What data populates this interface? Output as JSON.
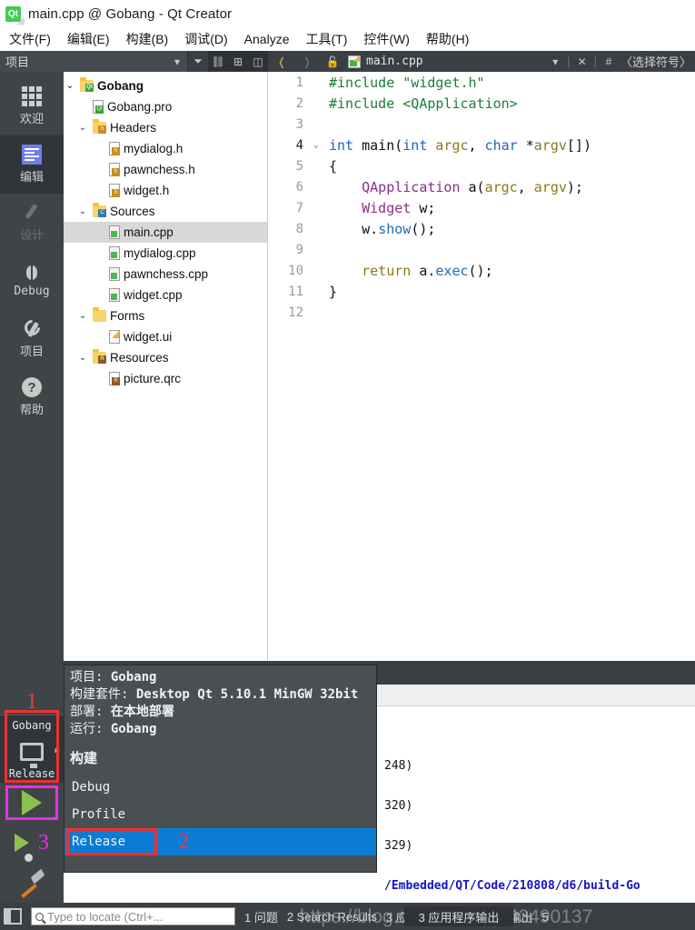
{
  "window": {
    "title": "main.cpp @ Gobang - Qt Creator",
    "logo_icon": "qt-logo-icon",
    "logo_text": "Qt"
  },
  "menubar": [
    {
      "label": "文件(F)"
    },
    {
      "label": "编辑(E)"
    },
    {
      "label": "构建(B)"
    },
    {
      "label": "调试(D)"
    },
    {
      "label": "Analyze"
    },
    {
      "label": "工具(T)"
    },
    {
      "label": "控件(W)"
    },
    {
      "label": "帮助(H)"
    }
  ],
  "toolbar": {
    "project_selector": "项目",
    "dropdown_icon": "chevron-down-icon",
    "filter_icon": "filter-icon",
    "link_icon": "link-icon",
    "split_icon": "split-add-icon",
    "sidebar_icon": "sidebar-toggle-icon",
    "back_icon": "back-arrow-icon",
    "forward_icon": "forward-arrow-icon",
    "lock_icon": "unlock-icon"
  },
  "editor_tab": {
    "file_icon": "cpp-file-icon",
    "filename": "main.cpp",
    "dropdown_icon": "chevron-down-icon",
    "close_icon": "close-icon",
    "hash": "#",
    "symbol_selector": "〈选择符号〉"
  },
  "modebar": [
    {
      "label": "欢迎",
      "icon": "grid-welcome-icon",
      "state": "normal"
    },
    {
      "label": "编辑",
      "icon": "edit-document-icon",
      "state": "active"
    },
    {
      "label": "设计",
      "icon": "pencil-design-icon",
      "state": "disabled"
    },
    {
      "label": "Debug",
      "icon": "bug-icon",
      "state": "normal"
    },
    {
      "label": "项目",
      "icon": "wrench-icon",
      "state": "normal"
    },
    {
      "label": "帮助",
      "icon": "question-circle-icon",
      "state": "normal"
    }
  ],
  "kit_selector": {
    "project": "Gobang",
    "config": "Release",
    "monitor_icon": "desktop-monitor-icon",
    "arrow_icon": "right-arrow-icon"
  },
  "run_buttons": {
    "run_icon": "run-play-icon",
    "debug_icon": "debug-play-bug-icon",
    "build_icon": "hammer-build-icon"
  },
  "annotations": [
    {
      "text": "1",
      "color": "#ef3a3a"
    },
    {
      "text": "2",
      "color": "#ef3a3a"
    },
    {
      "text": "3",
      "color": "#e831e8"
    }
  ],
  "project_tree": [
    {
      "label": "Gobang",
      "indent": 0,
      "chevron": "v",
      "icon": "folder-qt-project-icon",
      "bold": true,
      "selected": false
    },
    {
      "label": "Gobang.pro",
      "indent": 1,
      "chevron": "",
      "icon": "qt-pro-file-icon",
      "bold": false,
      "selected": false
    },
    {
      "label": "Headers",
      "indent": 1,
      "chevron": "v",
      "icon": "folder-headers-icon",
      "bold": false,
      "selected": false
    },
    {
      "label": "mydialog.h",
      "indent": 2,
      "chevron": "",
      "icon": "header-file-icon",
      "bold": false,
      "selected": false
    },
    {
      "label": "pawnchess.h",
      "indent": 2,
      "chevron": "",
      "icon": "header-file-icon",
      "bold": false,
      "selected": false
    },
    {
      "label": "widget.h",
      "indent": 2,
      "chevron": "",
      "icon": "header-file-icon",
      "bold": false,
      "selected": false
    },
    {
      "label": "Sources",
      "indent": 1,
      "chevron": "v",
      "icon": "folder-sources-icon",
      "bold": false,
      "selected": false
    },
    {
      "label": "main.cpp",
      "indent": 2,
      "chevron": "",
      "icon": "cpp-file-icon",
      "bold": false,
      "selected": true
    },
    {
      "label": "mydialog.cpp",
      "indent": 2,
      "chevron": "",
      "icon": "cpp-file-icon",
      "bold": false,
      "selected": false
    },
    {
      "label": "pawnchess.cpp",
      "indent": 2,
      "chevron": "",
      "icon": "cpp-file-icon",
      "bold": false,
      "selected": false
    },
    {
      "label": "widget.cpp",
      "indent": 2,
      "chevron": "",
      "icon": "cpp-file-icon",
      "bold": false,
      "selected": false
    },
    {
      "label": "Forms",
      "indent": 1,
      "chevron": "v",
      "icon": "folder-forms-icon",
      "bold": false,
      "selected": false
    },
    {
      "label": "widget.ui",
      "indent": 2,
      "chevron": "",
      "icon": "ui-file-icon",
      "bold": false,
      "selected": false
    },
    {
      "label": "Resources",
      "indent": 1,
      "chevron": "v",
      "icon": "folder-resources-icon",
      "bold": false,
      "selected": false
    },
    {
      "label": "picture.qrc",
      "indent": 2,
      "chevron": "",
      "icon": "qrc-file-icon",
      "bold": false,
      "selected": false
    }
  ],
  "code": {
    "lines": [
      {
        "n": "1",
        "fold": "",
        "tokens": [
          {
            "t": "#include ",
            "c": "k-pre"
          },
          {
            "t": "\"widget.h\"",
            "c": "k-str"
          }
        ]
      },
      {
        "n": "2",
        "fold": "",
        "tokens": [
          {
            "t": "#include ",
            "c": "k-pre"
          },
          {
            "t": "<QApplication>",
            "c": "k-str"
          }
        ]
      },
      {
        "n": "3",
        "fold": "",
        "tokens": []
      },
      {
        "n": "4",
        "fold": "v",
        "tokens": [
          {
            "t": "int ",
            "c": "k-kw"
          },
          {
            "t": "main(",
            "c": "k-plain"
          },
          {
            "t": "int ",
            "c": "k-kw"
          },
          {
            "t": "argc",
            "c": "k-var"
          },
          {
            "t": ", ",
            "c": "k-plain"
          },
          {
            "t": "char ",
            "c": "k-kw"
          },
          {
            "t": "*",
            "c": "k-plain"
          },
          {
            "t": "argv",
            "c": "k-var"
          },
          {
            "t": "[])",
            "c": "k-plain"
          }
        ]
      },
      {
        "n": "5",
        "fold": "",
        "tokens": [
          {
            "t": "{",
            "c": "k-plain"
          }
        ]
      },
      {
        "n": "6",
        "fold": "",
        "tokens": [
          {
            "t": "    ",
            "c": "k-plain"
          },
          {
            "t": "QApplication ",
            "c": "k-type"
          },
          {
            "t": "a(",
            "c": "k-plain"
          },
          {
            "t": "argc",
            "c": "k-var"
          },
          {
            "t": ", ",
            "c": "k-plain"
          },
          {
            "t": "argv",
            "c": "k-var"
          },
          {
            "t": ");",
            "c": "k-plain"
          }
        ]
      },
      {
        "n": "7",
        "fold": "",
        "tokens": [
          {
            "t": "    ",
            "c": "k-plain"
          },
          {
            "t": "Widget ",
            "c": "k-type"
          },
          {
            "t": "w;",
            "c": "k-plain"
          }
        ]
      },
      {
        "n": "8",
        "fold": "",
        "tokens": [
          {
            "t": "    w.",
            "c": "k-plain"
          },
          {
            "t": "show",
            "c": "k-fn"
          },
          {
            "t": "();",
            "c": "k-plain"
          }
        ]
      },
      {
        "n": "9",
        "fold": "",
        "tokens": []
      },
      {
        "n": "10",
        "fold": "",
        "tokens": [
          {
            "t": "    ",
            "c": "k-plain"
          },
          {
            "t": "return ",
            "c": "k-var"
          },
          {
            "t": "a.",
            "c": "k-plain"
          },
          {
            "t": "exec",
            "c": "k-fn"
          },
          {
            "t": "();",
            "c": "k-plain"
          }
        ]
      },
      {
        "n": "11",
        "fold": "",
        "tokens": [
          {
            "t": "}",
            "c": "k-plain"
          }
        ]
      },
      {
        "n": "12",
        "fold": "",
        "tokens": []
      }
    ]
  },
  "output_panel": {
    "toolbar_icons": [
      "clear-broom-icon",
      "prev-item-icon",
      "next-item-icon",
      "run-icon",
      "stop-icon",
      "rerun-icon",
      "zoom-in-icon",
      "zoom-out-icon"
    ],
    "lines": [
      {
        "text": "248)",
        "link": false
      },
      {
        "text": "320)",
        "link": false
      },
      {
        "text": "329)",
        "link": false
      },
      {
        "text": "/Embedded/QT/Code/210808/d6/build-Go",
        "link": true
      }
    ]
  },
  "popup": {
    "header": [
      {
        "label": "项目: ",
        "value": "Gobang"
      },
      {
        "label": "构建套件: ",
        "value": "Desktop Qt 5.10.1 MinGW 32bit"
      },
      {
        "label": "部署: ",
        "value": "在本地部署"
      },
      {
        "label": "运行: ",
        "value": "Gobang"
      }
    ],
    "section": "构建",
    "items": [
      {
        "label": "Debug",
        "active": false
      },
      {
        "label": "Profile",
        "active": false
      },
      {
        "label": "Release",
        "active": true
      }
    ]
  },
  "statusbar": {
    "toggle_icon": "sidebar-toggle-icon",
    "search_icon": "search-icon",
    "locator_placeholder": "Type to locate (Ctrl+...",
    "items": [
      {
        "label": "1 问题"
      },
      {
        "label": "2 Search Results"
      },
      {
        "label": "3 应用程序输出"
      },
      {
        "label": "4 编译输出"
      },
      {
        "label": "5"
      }
    ]
  },
  "watermark": {
    "text": "https://blog.csdn.net/qq_43490137"
  }
}
